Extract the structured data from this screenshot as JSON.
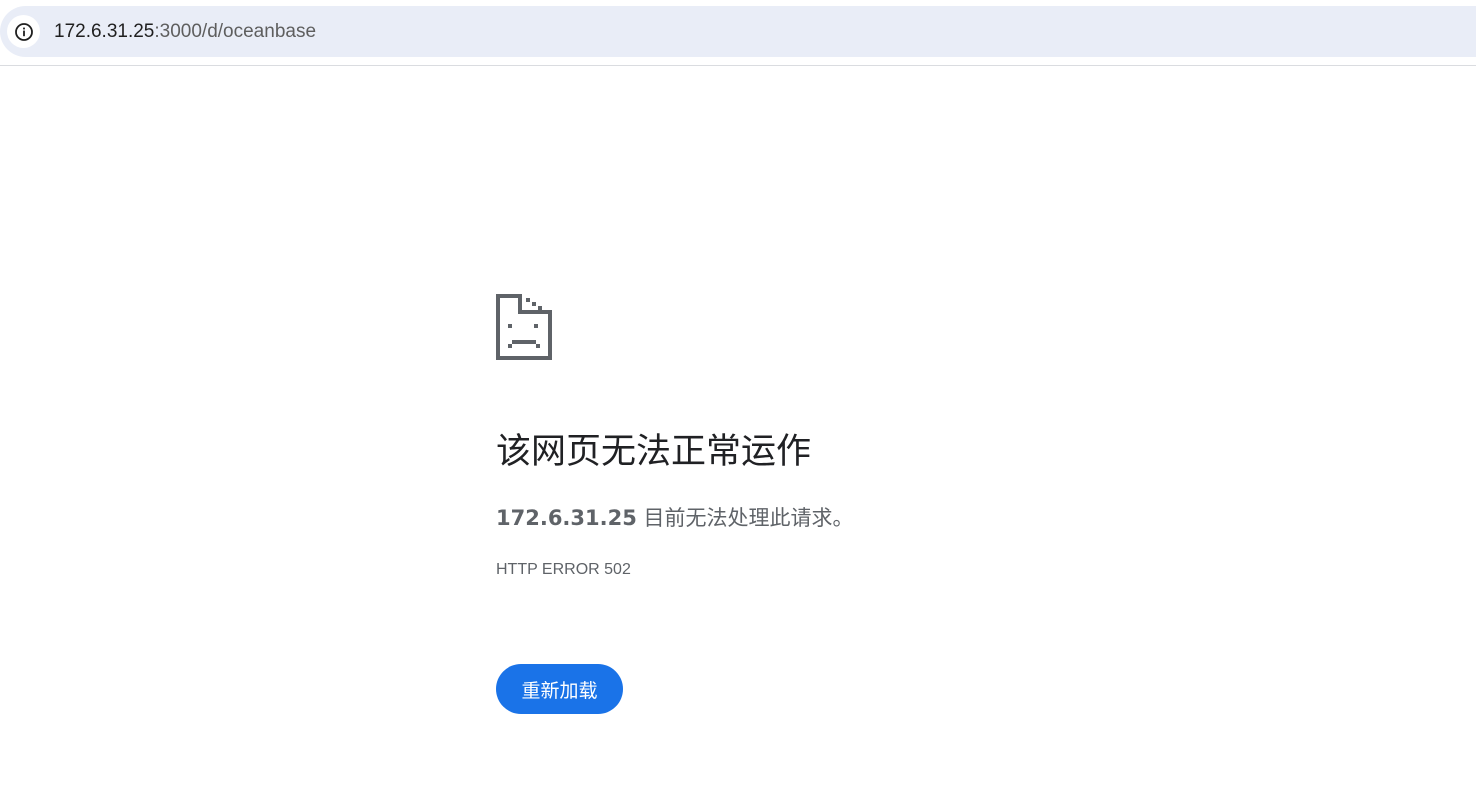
{
  "address_bar": {
    "host": "172.6.31.25",
    "rest": ":3000/d/oceanbase",
    "site_info_icon": "info-circle-icon"
  },
  "error_page": {
    "icon": "sad-document-icon",
    "title": "该网页无法正常运作",
    "description_host": "172.6.31.25",
    "description_text": " 目前无法处理此请求。",
    "error_code": "HTTP ERROR 502",
    "reload_label": "重新加载"
  },
  "colors": {
    "accent": "#1a73e8",
    "omnibox_bg": "#e9edf7",
    "icon_gray": "#5f6368"
  }
}
